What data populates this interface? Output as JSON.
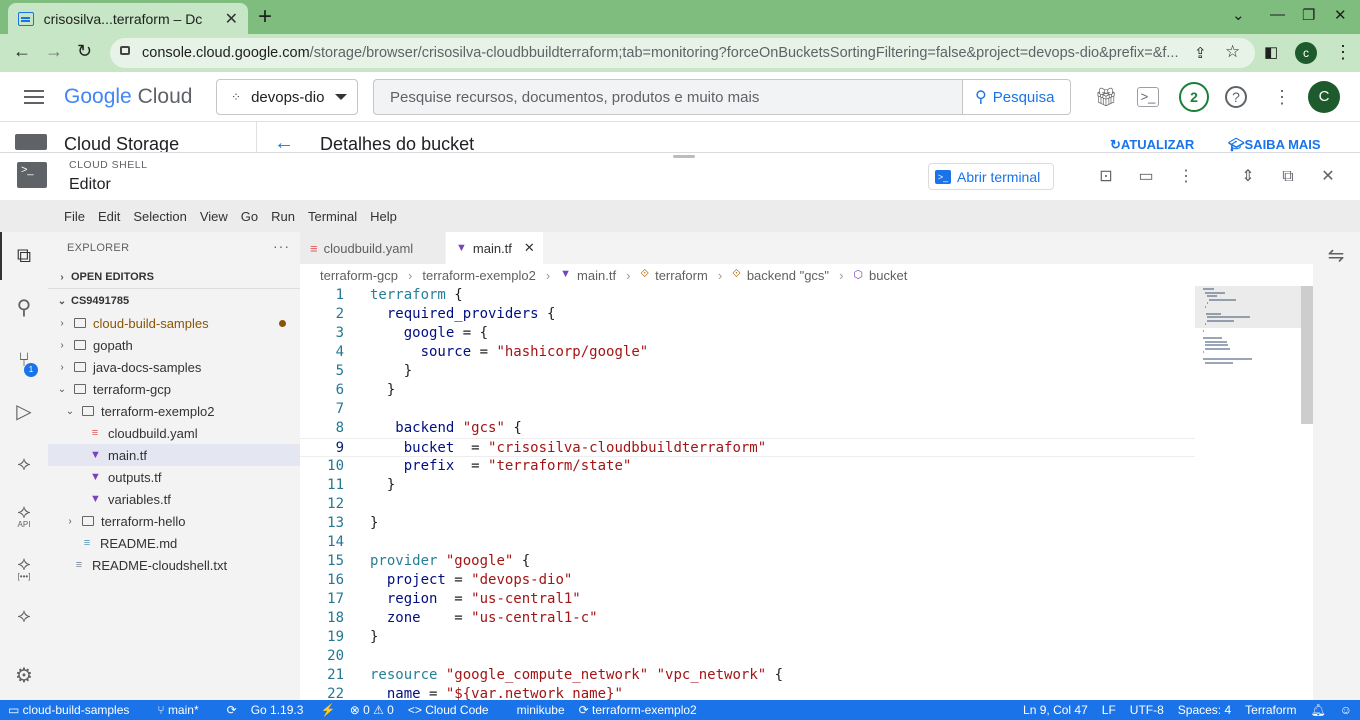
{
  "browser": {
    "tab_title": "crisosilva...terraform – Dc",
    "url_domain": "console.cloud.google.com",
    "url_rest": "/storage/browser/crisosilva-cloudbbuildterraform;tab=monitoring?forceOnBucketsSortingFiltering=false&project=devops-dio&prefix=&f...",
    "profile_initial": "c"
  },
  "gcp": {
    "logo_google": "Google",
    "logo_cloud": "Cloud",
    "project": "devops-dio",
    "search_placeholder": "Pesquise recursos, documentos, produtos e muito mais",
    "search_button": "Pesquisa",
    "notifications_count": "2",
    "avatar_initial": "C",
    "service_title": "Cloud Storage",
    "page_title": "Detalhes do bucket",
    "refresh_label": "ATUALIZAR",
    "learn_more_label": "SAIBA MAIS"
  },
  "cloudshell": {
    "label": "CLOUD SHELL",
    "title": "Editor",
    "open_terminal": "Abrir terminal"
  },
  "menubar": [
    "File",
    "Edit",
    "Selection",
    "View",
    "Go",
    "Run",
    "Terminal",
    "Help"
  ],
  "activity": {
    "scm_badge": "1",
    "api_label": "API",
    "brackets_label": "[•••]"
  },
  "explorer": {
    "title": "EXPLORER",
    "open_editors": "OPEN EDITORS",
    "workspace": "CS9491785",
    "tree": [
      {
        "name": "cloud-build-samples",
        "type": "folder",
        "depth": 0,
        "open": false,
        "modified": true
      },
      {
        "name": "gopath",
        "type": "folder",
        "depth": 0,
        "open": false
      },
      {
        "name": "java-docs-samples",
        "type": "folder",
        "depth": 0,
        "open": false
      },
      {
        "name": "terraform-gcp",
        "type": "folder",
        "depth": 0,
        "open": true
      },
      {
        "name": "terraform-exemplo2",
        "type": "folder",
        "depth": 1,
        "open": true
      },
      {
        "name": "cloudbuild.yaml",
        "type": "yaml",
        "depth": 2
      },
      {
        "name": "main.tf",
        "type": "tf",
        "depth": 2,
        "selected": true
      },
      {
        "name": "outputs.tf",
        "type": "tf",
        "depth": 2
      },
      {
        "name": "variables.tf",
        "type": "tf",
        "depth": 2
      },
      {
        "name": "terraform-hello",
        "type": "folder",
        "depth": 1,
        "open": false
      },
      {
        "name": "README.md",
        "type": "md",
        "depth": 1
      },
      {
        "name": "README-cloudshell.txt",
        "type": "txt",
        "depth": 0
      }
    ]
  },
  "editor": {
    "tabs": [
      {
        "label": "cloudbuild.yaml",
        "active": false
      },
      {
        "label": "main.tf",
        "active": true
      }
    ],
    "breadcrumbs": [
      "terraform-gcp",
      "terraform-exemplo2",
      "main.tf",
      "terraform",
      "backend \"gcs\"",
      "bucket"
    ],
    "current_line": 9,
    "lines": [
      "terraform {",
      "  required_providers {",
      "    google = {",
      "      source = \"hashicorp/google\"",
      "    }",
      "  }",
      "",
      "   backend \"gcs\" {",
      "    bucket  = \"crisosilva-cloudbbuildterraform\"",
      "    prefix  = \"terraform/state\"",
      "  }",
      "",
      "}",
      "",
      "provider \"google\" {",
      "  project = \"devops-dio\"",
      "  region  = \"us-central1\"",
      "  zone    = \"us-central1-c\"",
      "}",
      "",
      "resource \"google_compute_network\" \"vpc_network\" {",
      "  name = \"${var.network_name}\""
    ]
  },
  "statusbar": {
    "workspace": "cloud-build-samples",
    "branch": "main*",
    "go_version": "Go 1.19.3",
    "problems": "⊗ 0 ⚠ 0",
    "cloud_code": "Cloud Code",
    "minikube": "minikube",
    "project": "terraform-exemplo2",
    "cursor": "Ln 9, Col 47",
    "eol": "LF",
    "encoding": "UTF-8",
    "spaces": "Spaces: 4",
    "language": "Terraform"
  }
}
